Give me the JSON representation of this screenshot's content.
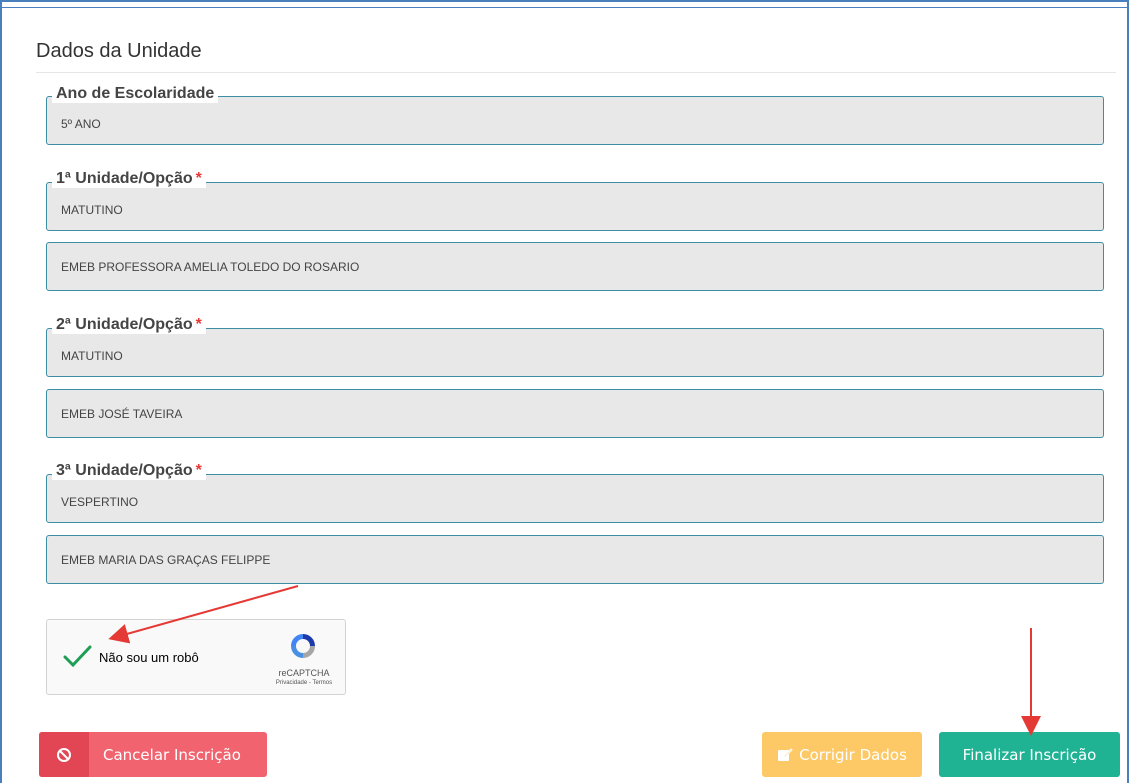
{
  "section": {
    "title": "Dados da Unidade"
  },
  "ano": {
    "legend": "Ano de Escolaridade",
    "value": "5º ANO"
  },
  "opcao1": {
    "legend": "1ª Unidade/Opção",
    "required": "*",
    "turno": "MATUTINO",
    "escola": "EMEB PROFESSORA AMELIA TOLEDO DO ROSARIO"
  },
  "opcao2": {
    "legend": "2ª Unidade/Opção",
    "required": "*",
    "turno": "MATUTINO",
    "escola": "EMEB JOSÉ TAVEIRA"
  },
  "opcao3": {
    "legend": "3ª Unidade/Opção",
    "required": "*",
    "turno": "VESPERTINO",
    "escola": "EMEB MARIA DAS GRAÇAS FELIPPE"
  },
  "captcha": {
    "label": "Não sou um robô",
    "brand": "reCAPTCHA",
    "terms": "Privacidade - Termos",
    "check_icon": "checkmark-icon",
    "logo_icon": "recaptcha-logo-icon"
  },
  "buttons": {
    "cancel_label": "Cancelar Inscrição",
    "cancel_icon": "ban-icon",
    "fix_label": "Corrigir Dados",
    "fix_icon": "edit-icon",
    "finish_label": "Finalizar Inscrição"
  },
  "colors": {
    "cancel": "#f0636f",
    "fix": "#fdc966",
    "finish": "#1fb394",
    "field_border": "#3d8da3",
    "annotation_arrow": "#e53935"
  }
}
